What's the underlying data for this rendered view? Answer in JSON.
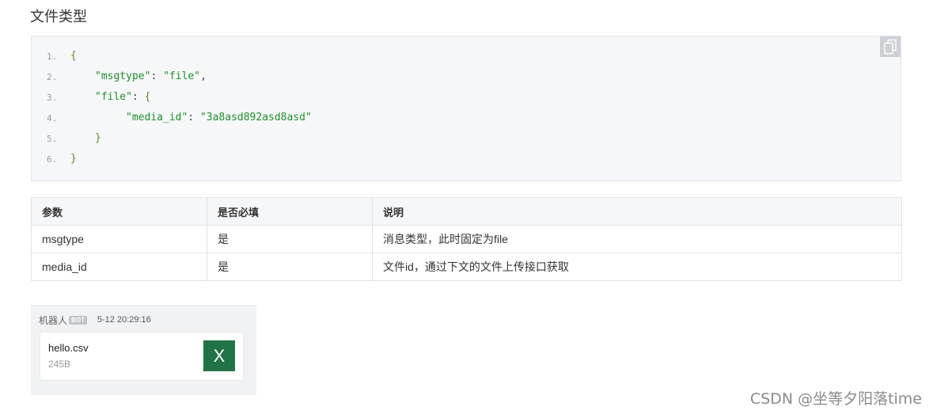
{
  "section_title": "文件类型",
  "code_block": {
    "copy_button_icon": "copy-icon",
    "line_numbers": [
      "1.",
      "2.",
      "3.",
      "4.",
      "5.",
      "6."
    ],
    "lines": [
      [
        "{"
      ],
      [
        "\"msgtype\"",
        ": ",
        "\"file\"",
        ","
      ],
      [
        "\"file\"",
        ": ",
        "{"
      ],
      [
        "\"media_id\"",
        ": ",
        "\"3a8asd892asd8asd\""
      ],
      [
        "}"
      ],
      [
        "}"
      ]
    ]
  },
  "params_table": {
    "headers": [
      "参数",
      "是否必填",
      "说明"
    ],
    "rows": [
      [
        "msgtype",
        "是",
        "消息类型，此时固定为file"
      ],
      [
        "media_id",
        "是",
        "文件id，通过下文的文件上传接口获取"
      ]
    ]
  },
  "message_preview": {
    "sender": "机器人",
    "badge": "BOT",
    "time": "5-12 20:29:16",
    "file": {
      "name": "hello.csv",
      "size": "245B",
      "icon": "excel-icon",
      "icon_letter": "X"
    }
  },
  "watermark": "CSDN @坐等夕阳落time",
  "colors": {
    "code_string": "#1f8f29",
    "code_brace": "#5f8a2c",
    "code_background": "#f6f7f9",
    "excel_icon": "#217346",
    "bot_badge": "#c2c4c7"
  }
}
